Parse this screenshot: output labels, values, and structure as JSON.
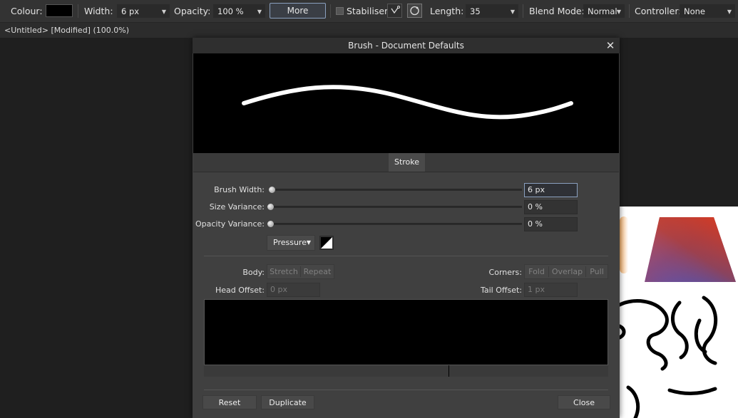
{
  "toolbar": {
    "colour_label": "Colour:",
    "width_label": "Width:",
    "width_value": "6 px",
    "opacity_label": "Opacity:",
    "opacity_value": "100 %",
    "more_label": "More",
    "stabiliser_label": "Stabiliser",
    "length_label": "Length:",
    "length_value": "35",
    "blend_label": "Blend Mode:",
    "blend_value": "Normal",
    "controller_label": "Controller:",
    "controller_value": "None",
    "colour_value": "#000000"
  },
  "document": {
    "title": "<Untitled> [Modified] (100.0%)"
  },
  "dialog": {
    "title": "Brush - Document Defaults",
    "tab_stroke": "Stroke",
    "brush_width_label": "Brush Width:",
    "brush_width_value": "6 px",
    "size_variance_label": "Size Variance:",
    "size_variance_value": "0 %",
    "opacity_variance_label": "Opacity Variance:",
    "opacity_variance_value": "0 %",
    "pressure_label": "Pressure",
    "body_label": "Body:",
    "body_stretch": "Stretch",
    "body_repeat": "Repeat",
    "corners_label": "Corners:",
    "corners_fold": "Fold",
    "corners_overlap": "Overlap",
    "corners_pull": "Pull",
    "head_offset_label": "Head Offset:",
    "head_offset_value": "0 px",
    "tail_offset_label": "Tail Offset:",
    "tail_offset_value": "1 px",
    "reset_label": "Reset",
    "duplicate_label": "Duplicate",
    "close_label": "Close"
  }
}
